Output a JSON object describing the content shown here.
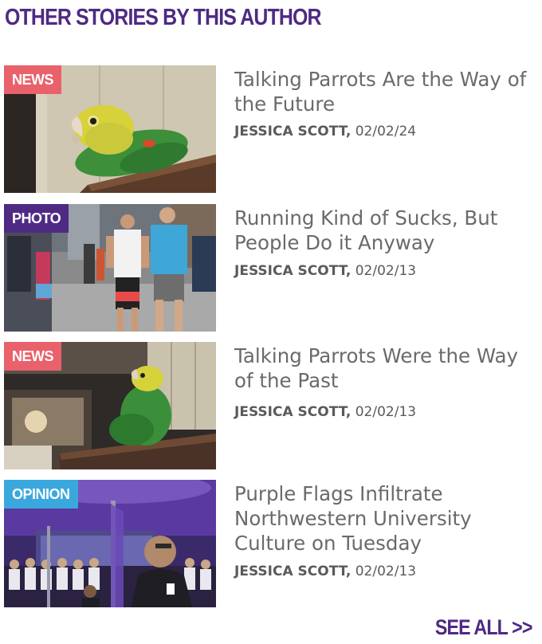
{
  "section_title": "OTHER STORIES BY THIS AUTHOR",
  "stories": [
    {
      "tag": "NEWS",
      "headline": "Talking Parrots Are the Way of the Future",
      "author": "JESSICA SCOTT,",
      "date": "02/02/24",
      "image": "parrot-photo"
    },
    {
      "tag": "PHOTO",
      "headline": "Running Kind of Sucks, But People Do it Anyway",
      "author": "JESSICA SCOTT,",
      "date": "02/02/13",
      "image": "marathon-runners-photo"
    },
    {
      "tag": "NEWS",
      "headline": "Talking Parrots Were the Way of the Past",
      "author": "JESSICA SCOTT,",
      "date": "02/02/13",
      "image": "parrot-photo"
    },
    {
      "tag": "OPINION",
      "headline": "Purple Flags Infiltrate Northwestern University Culture on Tuesday",
      "author": "JESSICA SCOTT,",
      "date": "02/02/13",
      "image": "purple-flags-event-photo"
    }
  ],
  "see_all": "SEE ALL >>",
  "colors": {
    "brand_purple": "#4e2a84",
    "tag_news": "#e8616b",
    "tag_photo": "#4e2a84",
    "tag_opinion": "#3aa8dd",
    "headline_gray": "#6a6a6a"
  }
}
